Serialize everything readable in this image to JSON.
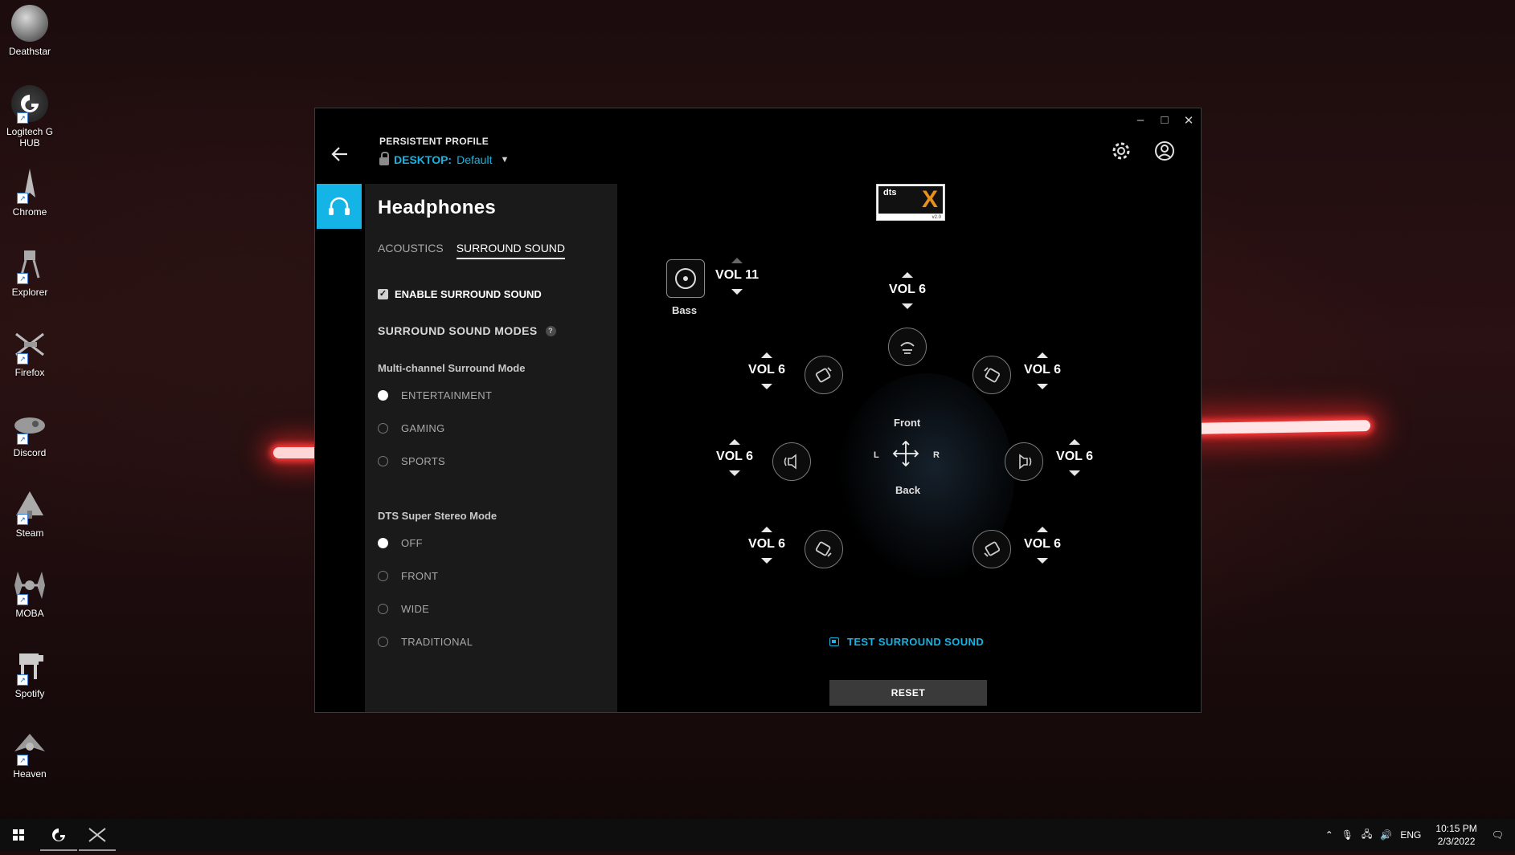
{
  "desktop": {
    "icons": [
      {
        "label": "Deathstar",
        "icon": "death-star-icon"
      },
      {
        "label": "Logitech G HUB",
        "icon": "logitech-g-icon"
      },
      {
        "label": "Chrome",
        "icon": "starship-icon"
      },
      {
        "label": "Explorer",
        "icon": "walker-icon"
      },
      {
        "label": "Firefox",
        "icon": "xwing-icon"
      },
      {
        "label": "Discord",
        "icon": "ship-icon"
      },
      {
        "label": "Steam",
        "icon": "shuttle-icon"
      },
      {
        "label": "MOBA",
        "icon": "tie-fighter-icon"
      },
      {
        "label": "Spotify",
        "icon": "at-at-icon"
      },
      {
        "label": "Heaven",
        "icon": "fighter-icon"
      }
    ]
  },
  "window": {
    "profile_label": "PERSISTENT PROFILE",
    "profile_name": "DESKTOP:",
    "profile_value": "Default",
    "device": "Headphones",
    "tabs": [
      {
        "label": "ACOUSTICS",
        "active": false
      },
      {
        "label": "SURROUND SOUND",
        "active": true
      }
    ],
    "enable_surround": {
      "label": "ENABLE SURROUND SOUND",
      "checked": true
    },
    "modes_heading": "SURROUND SOUND MODES",
    "help_glyph": "?",
    "multichannel": {
      "title": "Multi-channel Surround Mode",
      "options": [
        {
          "label": "ENTERTAINMENT",
          "selected": true
        },
        {
          "label": "GAMING",
          "selected": false
        },
        {
          "label": "SPORTS",
          "selected": false
        }
      ]
    },
    "super_stereo": {
      "title": "DTS Super Stereo Mode",
      "options": [
        {
          "label": "OFF",
          "selected": true
        },
        {
          "label": "FRONT",
          "selected": false
        },
        {
          "label": "WIDE",
          "selected": false
        },
        {
          "label": "TRADITIONAL",
          "selected": false
        }
      ]
    },
    "dts_logo": {
      "brand": "dts",
      "x": "X",
      "version": "v2.0"
    },
    "speakers": {
      "bass": {
        "label": "Bass",
        "vol": "VOL 11"
      },
      "center": {
        "vol": "VOL 6"
      },
      "front_left": {
        "vol": "VOL 6"
      },
      "front_right": {
        "vol": "VOL 6"
      },
      "side_left": {
        "vol": "VOL 6"
      },
      "side_right": {
        "vol": "VOL 6"
      },
      "rear_left": {
        "vol": "VOL 6"
      },
      "rear_right": {
        "vol": "VOL 6"
      }
    },
    "position": {
      "front": "Front",
      "back": "Back",
      "left": "L",
      "right": "R"
    },
    "test_link": "TEST SURROUND SOUND",
    "reset": "RESET",
    "controls": {
      "minimize": "–",
      "maximize": "□",
      "close": "✕"
    }
  },
  "taskbar": {
    "language": "ENG",
    "time": "10:15 PM",
    "date": "2/3/2022"
  },
  "colors": {
    "accent": "#14b4e6",
    "window_bg": "#000000",
    "panel_bg": "#1a1a1a"
  }
}
